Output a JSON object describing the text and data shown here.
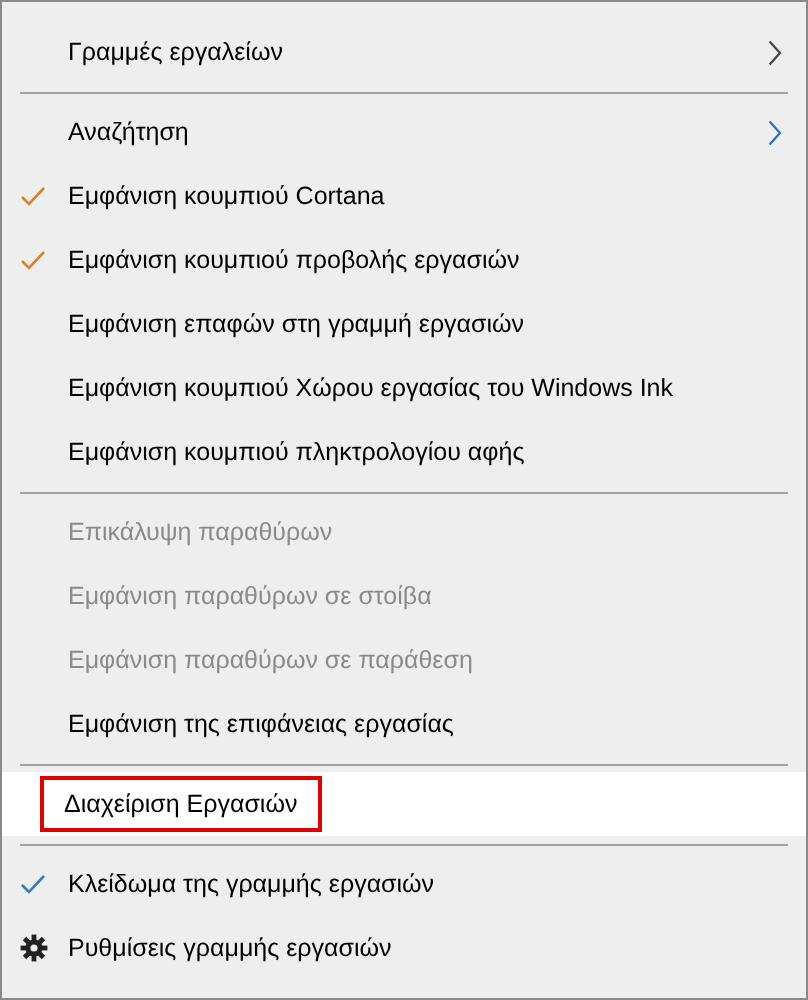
{
  "menu": [
    {
      "kind": "item",
      "label": "Γραμμές εργαλείων",
      "submenu": true,
      "checked": false,
      "disabled": false,
      "highlighted": false
    },
    {
      "kind": "separator"
    },
    {
      "kind": "item",
      "label": "Αναζήτηση",
      "submenu": true,
      "checked": false,
      "disabled": false,
      "highlighted": false
    },
    {
      "kind": "item",
      "label": "Εμφάνιση κουμπιού Cortana",
      "submenu": false,
      "checked": true,
      "color": "#d9822b",
      "disabled": false,
      "highlighted": false
    },
    {
      "kind": "item",
      "label": "Εμφάνιση κουμπιού προβολής εργασιών",
      "submenu": false,
      "checked": true,
      "color": "#d9822b",
      "disabled": false,
      "highlighted": false
    },
    {
      "kind": "item",
      "label": "Εμφάνιση επαφών στη γραμμή εργασιών",
      "submenu": false,
      "checked": false,
      "disabled": false,
      "highlighted": false
    },
    {
      "kind": "item",
      "label": "Εμφάνιση κουμπιού Χώρου εργασίας του Windows Ink",
      "submenu": false,
      "checked": false,
      "disabled": false,
      "highlighted": false
    },
    {
      "kind": "item",
      "label": "Εμφάνιση κουμπιού πληκτρολογίου αφής",
      "submenu": false,
      "checked": false,
      "disabled": false,
      "highlighted": false
    },
    {
      "kind": "separator"
    },
    {
      "kind": "item",
      "label": "Επικάλυψη παραθύρων",
      "submenu": false,
      "checked": false,
      "disabled": true,
      "highlighted": false
    },
    {
      "kind": "item",
      "label": "Εμφάνιση παραθύρων σε στοίβα",
      "submenu": false,
      "checked": false,
      "disabled": true,
      "highlighted": false
    },
    {
      "kind": "item",
      "label": "Εμφάνιση παραθύρων σε παράθεση",
      "submenu": false,
      "checked": false,
      "disabled": true,
      "highlighted": false
    },
    {
      "kind": "item",
      "label": "Εμφάνιση της επιφάνειας εργασίας",
      "submenu": false,
      "checked": false,
      "disabled": false,
      "highlighted": false
    },
    {
      "kind": "separator"
    },
    {
      "kind": "item",
      "label": "Διαχείριση Εργασιών",
      "submenu": false,
      "checked": false,
      "disabled": false,
      "highlighted": true
    },
    {
      "kind": "separator"
    },
    {
      "kind": "item",
      "label": "Κλείδωμα της γραμμής εργασιών",
      "submenu": false,
      "checked": true,
      "color": "#3a78c2",
      "disabled": false,
      "highlighted": false
    },
    {
      "kind": "settings",
      "label": "Ρυθμίσεις γραμμής εργασιών",
      "submenu": false,
      "checked": false,
      "disabled": false,
      "highlighted": false
    }
  ]
}
